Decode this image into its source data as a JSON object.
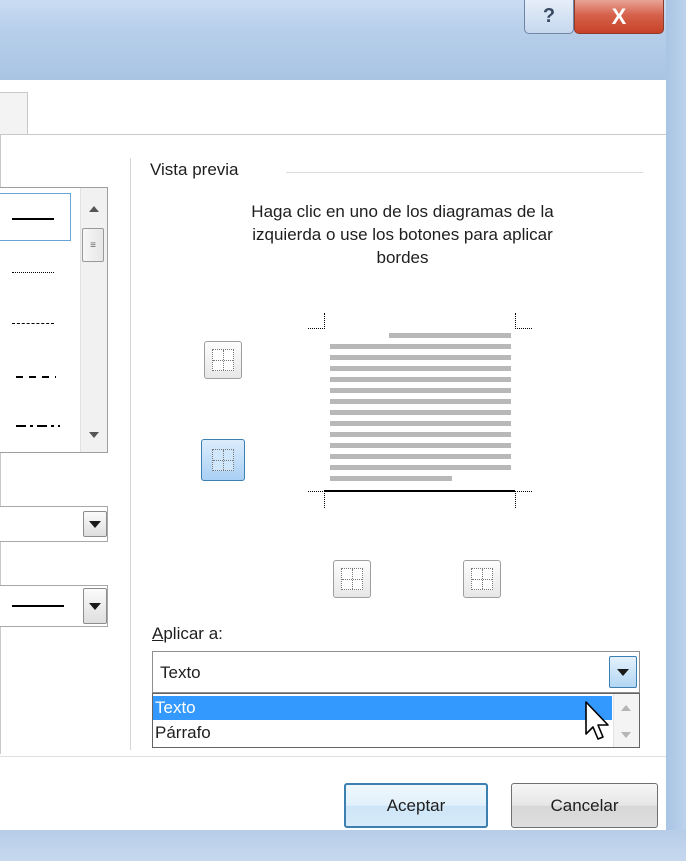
{
  "window": {
    "help_glyph": "?",
    "close_glyph": "X"
  },
  "preview": {
    "group_title": "Vista previa",
    "instructions": "Haga clic en uno de los diagramas de la izquierda o use los botones para aplicar bordes"
  },
  "apply": {
    "label_underlined": "A",
    "label_rest": "plicar a:",
    "value": "Texto",
    "options": [
      {
        "label": "Texto",
        "selected": true
      },
      {
        "label": "Párrafo",
        "selected": false
      }
    ]
  },
  "buttons": {
    "ok_label": "Aceptar",
    "cancel_label": "Cancelar"
  },
  "colors": {
    "selection": "#3399ff",
    "close_button": "#c74227",
    "accent_border": "#3c7fb1"
  },
  "icons": {
    "help": "question-icon",
    "close": "close-icon",
    "border_buttons": "border-grid-icon",
    "cursor": "mouse-pointer-icon"
  }
}
